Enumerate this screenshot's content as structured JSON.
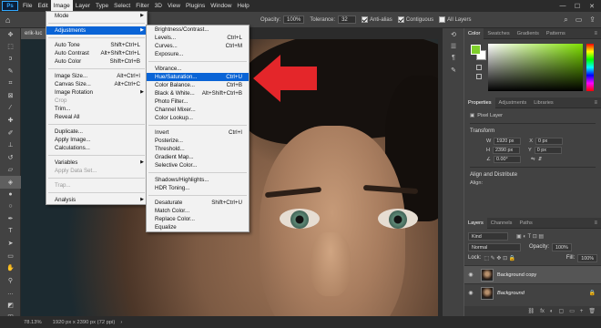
{
  "menubar": {
    "logo": "Ps",
    "items": [
      "File",
      "Edit",
      "Image",
      "Layer",
      "Type",
      "Select",
      "Filter",
      "3D",
      "View",
      "Plugins",
      "Window",
      "Help"
    ],
    "window_controls": [
      "—",
      "☐",
      "✕"
    ]
  },
  "options": {
    "opacity_label": "Opacity:",
    "opacity_value": "100%",
    "tolerance_label": "Tolerance:",
    "tolerance_value": "32",
    "anti_alias": "Anti-alias",
    "contiguous": "Contiguous",
    "all_layers": "All Layers"
  },
  "document": {
    "tab": "erik-luc",
    "zoom": "78.13%",
    "info": "1920 px x 2390 px (72 ppi)"
  },
  "image_menu": [
    {
      "label": "Mode",
      "submenu": true
    },
    {
      "sep": true
    },
    {
      "label": "Adjustments",
      "submenu": true,
      "highlight": true
    },
    {
      "sep": true
    },
    {
      "label": "Auto Tone",
      "shortcut": "Shift+Ctrl+L"
    },
    {
      "label": "Auto Contrast",
      "shortcut": "Alt+Shift+Ctrl+L"
    },
    {
      "label": "Auto Color",
      "shortcut": "Shift+Ctrl+B"
    },
    {
      "sep": true
    },
    {
      "label": "Image Size...",
      "shortcut": "Alt+Ctrl+I"
    },
    {
      "label": "Canvas Size...",
      "shortcut": "Alt+Ctrl+C"
    },
    {
      "label": "Image Rotation",
      "submenu": true
    },
    {
      "label": "Crop",
      "disabled": true
    },
    {
      "label": "Trim..."
    },
    {
      "label": "Reveal All"
    },
    {
      "sep": true
    },
    {
      "label": "Duplicate..."
    },
    {
      "label": "Apply Image..."
    },
    {
      "label": "Calculations..."
    },
    {
      "sep": true
    },
    {
      "label": "Variables",
      "submenu": true
    },
    {
      "label": "Apply Data Set...",
      "disabled": true
    },
    {
      "sep": true
    },
    {
      "label": "Trap...",
      "disabled": true
    },
    {
      "sep": true
    },
    {
      "label": "Analysis",
      "submenu": true
    }
  ],
  "adjustments_menu": [
    {
      "label": "Brightness/Contrast..."
    },
    {
      "label": "Levels...",
      "shortcut": "Ctrl+L"
    },
    {
      "label": "Curves...",
      "shortcut": "Ctrl+M"
    },
    {
      "label": "Exposure..."
    },
    {
      "sep": true
    },
    {
      "label": "Vibrance..."
    },
    {
      "label": "Hue/Saturation...",
      "shortcut": "Ctrl+U",
      "highlight": true
    },
    {
      "label": "Color Balance...",
      "shortcut": "Ctrl+B"
    },
    {
      "label": "Black & White...",
      "shortcut": "Alt+Shift+Ctrl+B"
    },
    {
      "label": "Photo Filter..."
    },
    {
      "label": "Channel Mixer..."
    },
    {
      "label": "Color Lookup..."
    },
    {
      "sep": true
    },
    {
      "label": "Invert",
      "shortcut": "Ctrl+I"
    },
    {
      "label": "Posterize..."
    },
    {
      "label": "Threshold..."
    },
    {
      "label": "Gradient Map..."
    },
    {
      "label": "Selective Color..."
    },
    {
      "sep": true
    },
    {
      "label": "Shadows/Highlights..."
    },
    {
      "label": "HDR Toning..."
    },
    {
      "sep": true
    },
    {
      "label": "Desaturate",
      "shortcut": "Shift+Ctrl+U"
    },
    {
      "label": "Match Color..."
    },
    {
      "label": "Replace Color..."
    },
    {
      "label": "Equalize"
    }
  ],
  "color_panel": {
    "tabs": [
      "Color",
      "Swatches",
      "Gradients",
      "Patterns"
    ],
    "foreground": "#7fcf2c"
  },
  "properties_panel": {
    "tabs": [
      "Properties",
      "Adjustments",
      "Libraries"
    ],
    "kind": "Pixel Layer",
    "transform_title": "Transform",
    "w_label": "W",
    "w_value": "1920 px",
    "h_label": "H",
    "h_value": "2390 px",
    "x_label": "X",
    "x_value": "0 px",
    "y_label": "Y",
    "y_value": "0 px",
    "angle_value": "0.00°",
    "align_title": "Align and Distribute",
    "align_sub": "Align:"
  },
  "layers_panel": {
    "tabs": [
      "Layers",
      "Channels",
      "Paths"
    ],
    "kind_label": "Kind",
    "blend_mode": "Normal",
    "opacity_label": "Opacity:",
    "opacity_value": "100%",
    "lock_label": "Lock:",
    "fill_label": "Fill:",
    "fill_value": "100%",
    "layers": [
      {
        "name": "Background copy",
        "selected": true
      },
      {
        "name": "Background",
        "locked": true
      }
    ],
    "footer_icons": [
      "fx",
      "◐",
      "▢",
      "▭",
      "+",
      "🗑"
    ]
  },
  "annotation": {
    "arrow_color": "#e4262a"
  }
}
